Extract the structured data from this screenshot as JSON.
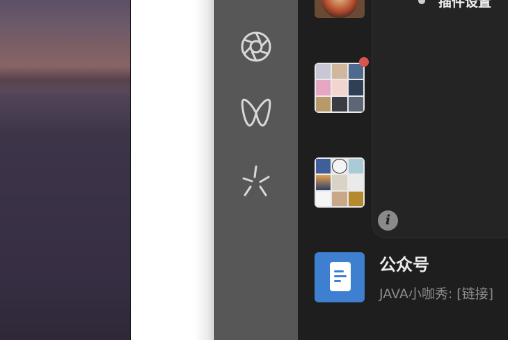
{
  "sidebar": {
    "icons": [
      {
        "name": "aperture-icon",
        "label": ""
      },
      {
        "name": "butterfly-icon",
        "label": ""
      },
      {
        "name": "sparkle-icon",
        "label": ""
      }
    ]
  },
  "popup": {
    "top_text": "插件设置",
    "info_glyph": "i"
  },
  "chats": {
    "group1": {
      "unread": true
    },
    "group2": {
      "unread": false
    },
    "official_account": {
      "title": "公众号",
      "preview": "JAVA小咖秀: [链接]"
    }
  },
  "colors": {
    "sidebar_bg": "#575757",
    "list_bg": "#1e1e1e",
    "badge": "#d9534f",
    "official_icon": "#3f7fd0"
  }
}
